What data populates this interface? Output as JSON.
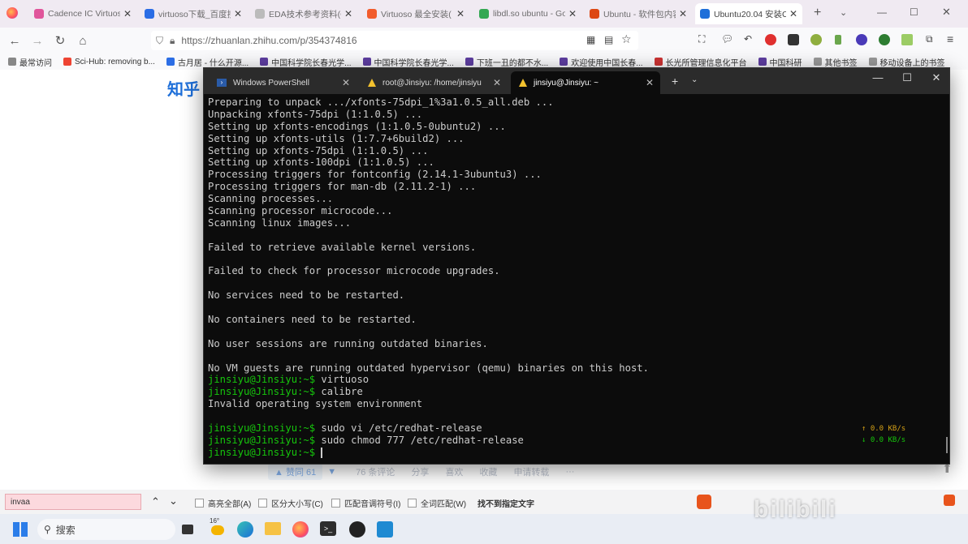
{
  "browser": {
    "tabs": [
      {
        "title": "Cadence IC Virtuos",
        "color": "#e0559b"
      },
      {
        "title": "virtuoso下载_百度搜",
        "color": "#2b6de5"
      },
      {
        "title": "EDA技术参考资料(Cade",
        "color": "#bbbbbb"
      },
      {
        "title": "Virtuoso 最全安装(",
        "color": "#f25c2c"
      },
      {
        "title": "libdl.so ubuntu - Go",
        "color": "#34a853"
      },
      {
        "title": "Ubuntu - 软件包内容",
        "color": "#dd4814"
      },
      {
        "title": "Ubuntu20.04 安装C",
        "color": "#1e6fd9"
      }
    ],
    "url": "https://zhuanlan.zhihu.com/p/354374816",
    "bookmarks": [
      "最常访问",
      "Sci-Hub: removing b...",
      "古月居 - 什么开源...",
      "中国科学院长春光学...",
      "中国科学院长春光学...",
      "下班一丑的都不水...",
      "欢迎使用中国长春...",
      "长光所管理信息化平台",
      "中国科研",
      "其他书签",
      "移动设备上的书签"
    ]
  },
  "page": {
    "logo": "知乎",
    "upvote": "▲ 赞同 61",
    "actions": [
      "76 条评论",
      "分享",
      "喜欢",
      "收藏",
      "申请转载",
      "···"
    ]
  },
  "terminal": {
    "tabs": [
      "Windows PowerShell",
      "root@Jinsiyu: /home/jinsiyu",
      "jinsiyu@Jinsiyu: ~"
    ],
    "lines": [
      {
        "text": "Preparing to unpack .../xfonts-75dpi_1%3a1.0.5_all.deb ..."
      },
      {
        "text": "Unpacking xfonts-75dpi (1:1.0.5) ..."
      },
      {
        "text": "Setting up xfonts-encodings (1:1.0.5-0ubuntu2) ..."
      },
      {
        "text": "Setting up xfonts-utils (1:7.7+6build2) ..."
      },
      {
        "text": "Setting up xfonts-75dpi (1:1.0.5) ..."
      },
      {
        "text": "Setting up xfonts-100dpi (1:1.0.5) ..."
      },
      {
        "text": "Processing triggers for fontconfig (2.14.1-3ubuntu3) ..."
      },
      {
        "text": "Processing triggers for man-db (2.11.2-1) ..."
      },
      {
        "text": "Scanning processes..."
      },
      {
        "text": "Scanning processor microcode..."
      },
      {
        "text": "Scanning linux images..."
      },
      {
        "text": ""
      },
      {
        "text": "Failed to retrieve available kernel versions."
      },
      {
        "text": ""
      },
      {
        "text": "Failed to check for processor microcode upgrades."
      },
      {
        "text": ""
      },
      {
        "text": "No services need to be restarted."
      },
      {
        "text": ""
      },
      {
        "text": "No containers need to be restarted."
      },
      {
        "text": ""
      },
      {
        "text": "No user sessions are running outdated binaries."
      },
      {
        "text": ""
      },
      {
        "text": "No VM guests are running outdated hypervisor (qemu) binaries on this host."
      },
      {
        "prompt": "jinsiyu@Jinsiyu:~$",
        "text": " virtuoso"
      },
      {
        "prompt": "jinsiyu@Jinsiyu:~$",
        "text": " calibre"
      },
      {
        "text": "Invalid operating system environment"
      },
      {
        "text": ""
      },
      {
        "prompt": "jinsiyu@Jinsiyu:~$",
        "text": " sudo vi /etc/redhat-release"
      },
      {
        "prompt": "jinsiyu@Jinsiyu:~$",
        "text": " sudo chmod 777 /etc/redhat-release"
      },
      {
        "prompt": "jinsiyu@Jinsiyu:~$",
        "text": " ",
        "cursor": true
      }
    ],
    "net_up": "↑ 0.0 KB/s",
    "net_down": "↓ 0.0 KB/s"
  },
  "findbar": {
    "query": "invaa",
    "options": [
      "高亮全部(A)",
      "区分大小写(C)",
      "匹配音调符号(I)",
      "全词匹配(W)"
    ],
    "status": "找不到指定文字"
  },
  "taskbar": {
    "search_placeholder": "搜索",
    "weather": "16°"
  },
  "colors": {
    "accent": "#1e6fd9",
    "prompt": "#16c60c",
    "terminal_bg": "#0c0c0c"
  }
}
